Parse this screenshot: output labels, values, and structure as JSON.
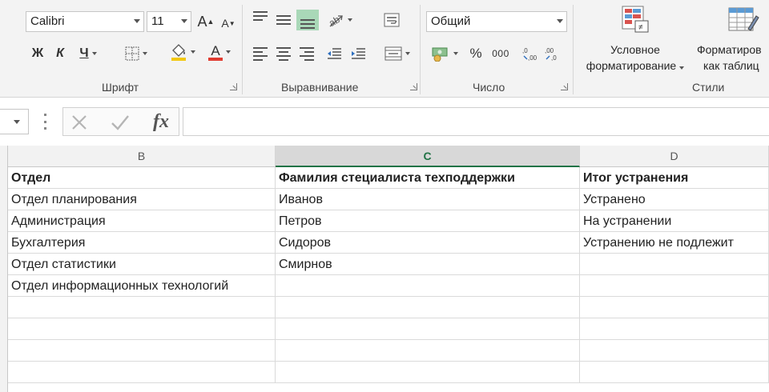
{
  "font": {
    "name": "Calibri",
    "size": "11",
    "grow_icon": "A",
    "shrink_icon": "A",
    "bold": "Ж",
    "italic": "К",
    "underline": "Ч",
    "font_color_icon": "A",
    "group_label": "Шрифт"
  },
  "alignment": {
    "group_label": "Выравнивание"
  },
  "number": {
    "format": "Общий",
    "percent": "%",
    "thousands": "000",
    "group_label": "Число"
  },
  "styles": {
    "conditional_line1": "Условное",
    "conditional_line2": "форматирование",
    "table_line1": "Форматиров",
    "table_line2": "как таблиц",
    "group_label": "Стили"
  },
  "formula_bar": {
    "fx": "fx",
    "value": ""
  },
  "columns": [
    {
      "letter": "B",
      "selected": false
    },
    {
      "letter": "C",
      "selected": true
    },
    {
      "letter": "D",
      "selected": false
    }
  ],
  "rows": [
    {
      "b": "Отдел",
      "c": "Фамилия стециалиста техподдержки",
      "d": "Итог устранения",
      "header": true
    },
    {
      "b": "Отдел планирования",
      "c": "Иванов",
      "d": "Устранено"
    },
    {
      "b": "Администрация",
      "c": "Петров",
      "d": "На устранении"
    },
    {
      "b": "Бухгалтерия",
      "c": "Сидоров",
      "d": "Устранению не подлежит"
    },
    {
      "b": "Отдел статистики",
      "c": "Смирнов",
      "d": ""
    },
    {
      "b": "Отдел информационных технологий",
      "c": "",
      "d": ""
    },
    {
      "b": "",
      "c": "",
      "d": ""
    },
    {
      "b": "",
      "c": "",
      "d": ""
    },
    {
      "b": "",
      "c": "",
      "d": ""
    },
    {
      "b": "",
      "c": "",
      "d": ""
    }
  ],
  "colors": {
    "accent": "#217346",
    "highlight": "#f2c811",
    "font_red": "#e03c31"
  }
}
